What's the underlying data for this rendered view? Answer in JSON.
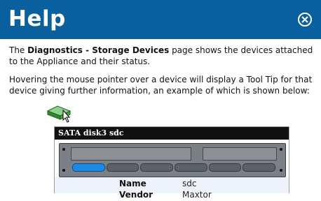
{
  "header": {
    "title": "Help",
    "close_icon": "close-circle-icon"
  },
  "content": {
    "para1_prefix": "The ",
    "para1_bold": "Diagnostics - Storage Devices",
    "para1_suffix": " page shows the devices attached to the Appliance and their status.",
    "para2": "Hovering the mouse pointer over a device will display a Tool Tip for that device giving further information, an example of which is shown below:"
  },
  "tooltip": {
    "title": "SATA disk3 sdc",
    "rows": [
      {
        "label": "Name",
        "value": "sdc"
      },
      {
        "label": "Vendor",
        "value": "Maxtor"
      }
    ]
  },
  "colors": {
    "header_bg": "#0a5f9e",
    "accent_blue": "#1e88e5",
    "drive_green": "#3aa53a"
  }
}
